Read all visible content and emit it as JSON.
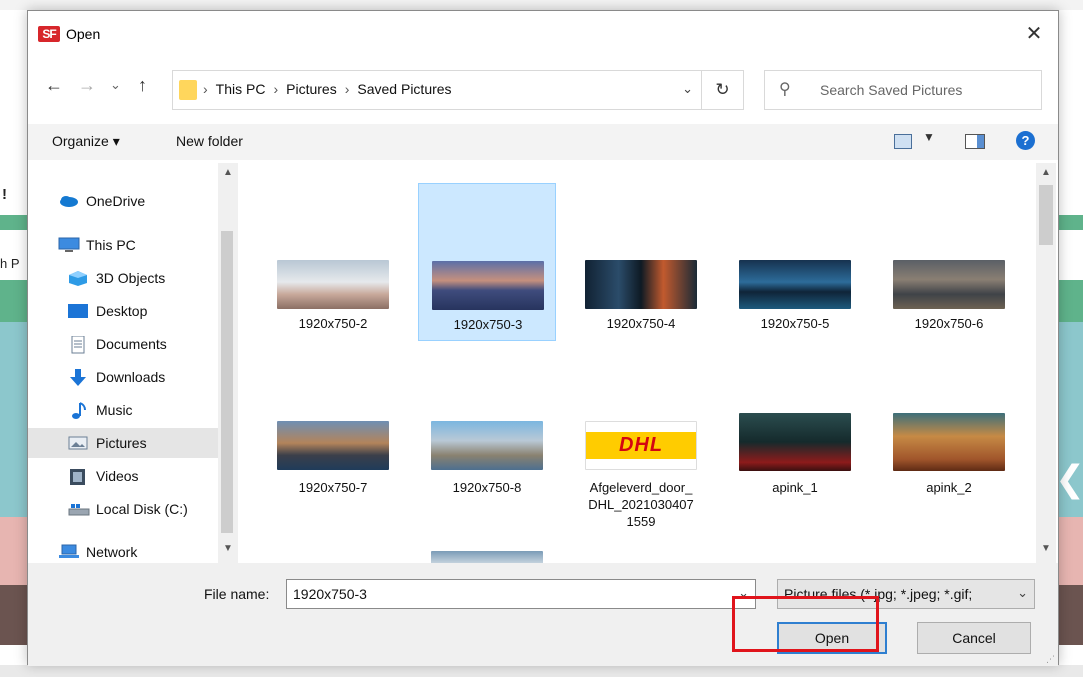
{
  "background": {
    "fragment_1": "!",
    "fragment_2": "h P"
  },
  "dialog": {
    "app_icon": "SF",
    "title": "Open",
    "close": "✕"
  },
  "nav": {
    "back": "←",
    "forward": "→",
    "recent": "⌄",
    "up": "↑",
    "breadcrumb": [
      "This PC",
      "Pictures",
      "Saved Pictures"
    ],
    "separator": "›",
    "refresh": "↻",
    "search_placeholder": "Search Saved Pictures"
  },
  "toolbar": {
    "organize": "Organize ▾",
    "new_folder": "New folder",
    "help": "?"
  },
  "sidebar": {
    "items": [
      {
        "label": "OneDrive",
        "icon": "onedrive-icon"
      },
      {
        "label": "This PC",
        "icon": "computer-icon"
      },
      {
        "label": "3D Objects",
        "icon": "3d-objects-icon"
      },
      {
        "label": "Desktop",
        "icon": "desktop-icon"
      },
      {
        "label": "Documents",
        "icon": "documents-icon"
      },
      {
        "label": "Downloads",
        "icon": "downloads-icon"
      },
      {
        "label": "Music",
        "icon": "music-icon"
      },
      {
        "label": "Pictures",
        "icon": "pictures-icon",
        "selected": true
      },
      {
        "label": "Videos",
        "icon": "videos-icon"
      },
      {
        "label": "Local Disk (C:)",
        "icon": "disk-icon"
      },
      {
        "label": "Network",
        "icon": "network-icon"
      }
    ]
  },
  "files": [
    {
      "name": "1920x750-2"
    },
    {
      "name": "1920x750-3",
      "selected": true
    },
    {
      "name": "1920x750-4"
    },
    {
      "name": "1920x750-5"
    },
    {
      "name": "1920x750-6"
    },
    {
      "name": "1920x750-7"
    },
    {
      "name": "1920x750-8"
    },
    {
      "name": "Afgeleverd_door_\nDHL_2021030407\n1559"
    },
    {
      "name": "apink_1"
    },
    {
      "name": "apink_2"
    },
    {
      "name": ""
    }
  ],
  "footer": {
    "file_name_label": "File name:",
    "file_name_value": "1920x750-3",
    "file_type": "Picture files (*.jpg; *.jpeg; *.gif;",
    "open_label": "Open",
    "cancel_label": "Cancel"
  },
  "thumb_logo": "DHL",
  "colors": {
    "selection": "#cce8ff",
    "highlight": "#e0141b",
    "accent": "#1b6fd1"
  }
}
